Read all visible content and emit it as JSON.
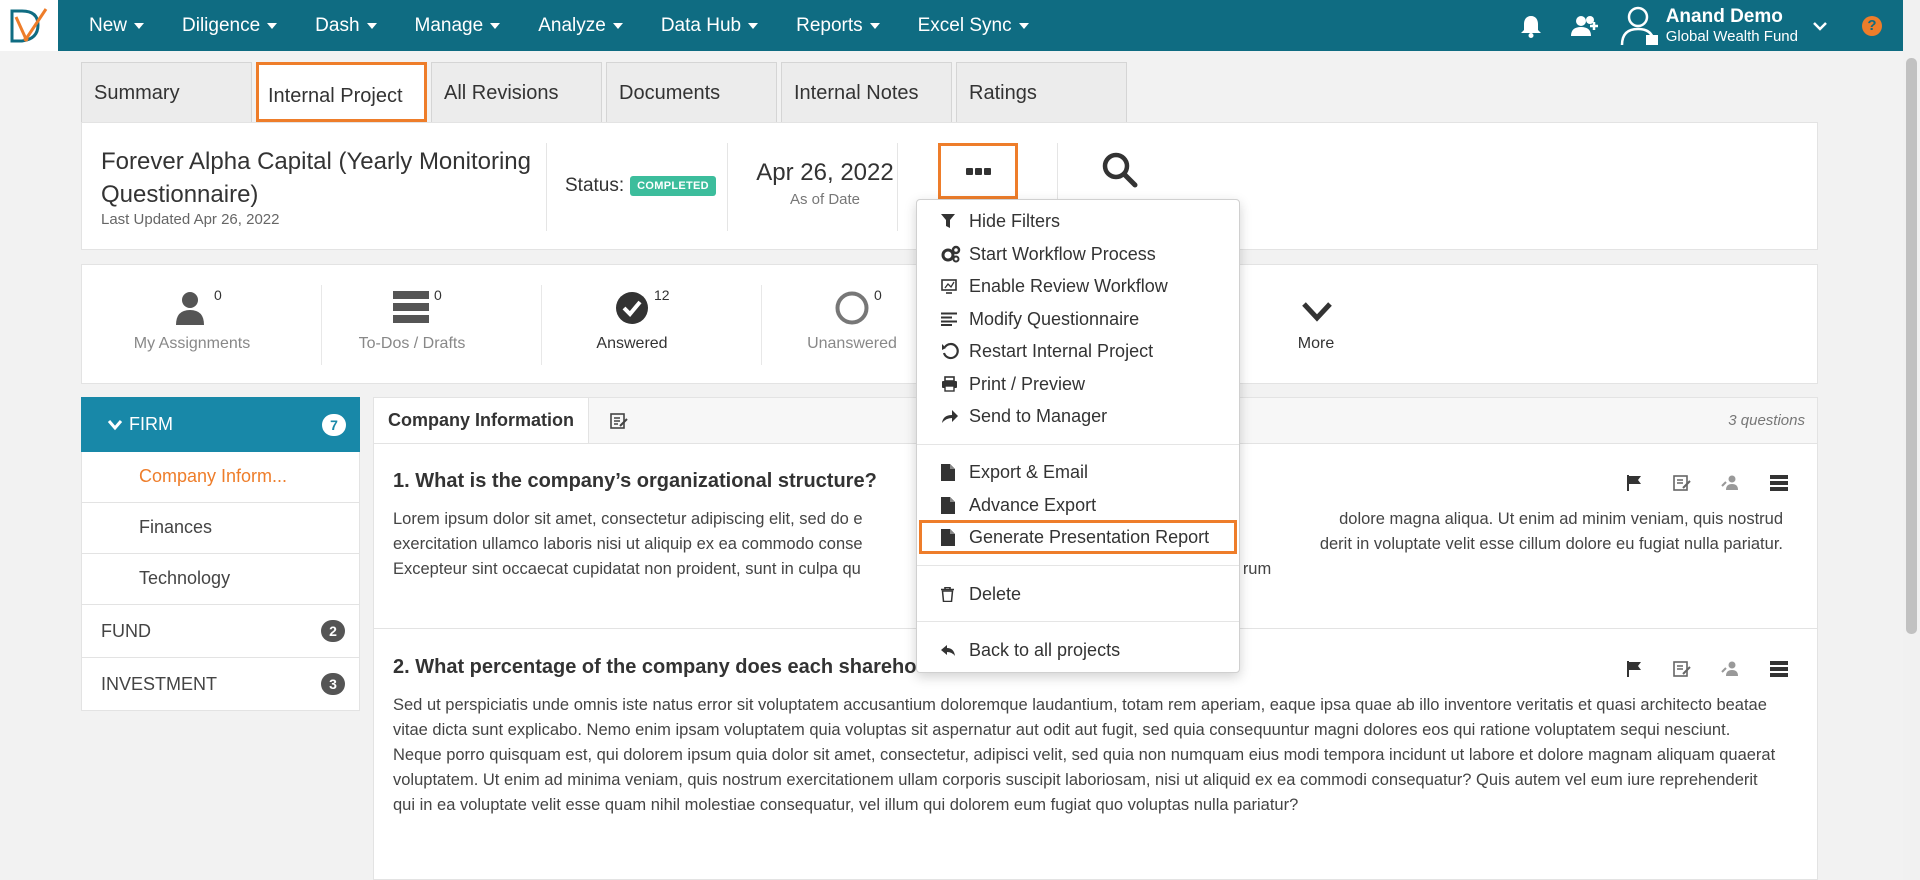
{
  "nav": {
    "items": [
      {
        "label": "New"
      },
      {
        "label": "Diligence"
      },
      {
        "label": "Dash"
      },
      {
        "label": "Manage"
      },
      {
        "label": "Analyze"
      },
      {
        "label": "Data Hub"
      },
      {
        "label": "Reports"
      },
      {
        "label": "Excel Sync"
      }
    ],
    "user_name": "Anand Demo",
    "user_org": "Global Wealth Fund",
    "help_label": "?"
  },
  "tabs": [
    {
      "label": "Summary"
    },
    {
      "label": "Internal Project"
    },
    {
      "label": "All Revisions"
    },
    {
      "label": "Documents"
    },
    {
      "label": "Internal Notes"
    },
    {
      "label": "Ratings"
    }
  ],
  "project": {
    "title": "Forever Alpha Capital (Yearly Monitoring Questionnaire)",
    "updated": "Last Updated Apr 26, 2022",
    "status_label": "Status:",
    "status_badge": "COMPLETED",
    "as_of_date": "Apr 26, 2022",
    "as_of_label": "As of Date"
  },
  "stats": [
    {
      "label": "My Assignments",
      "count": "0"
    },
    {
      "label": "To-Dos / Drafts",
      "count": "0"
    },
    {
      "label": "Answered",
      "count": "12"
    },
    {
      "label": "Unanswered",
      "count": "0"
    },
    {
      "label": "More",
      "count": ""
    }
  ],
  "sidebar": {
    "firm": {
      "label": "FIRM",
      "count": "7"
    },
    "firm_items": [
      {
        "label": "Company Inform..."
      },
      {
        "label": "Finances"
      },
      {
        "label": "Technology"
      }
    ],
    "sections": [
      {
        "label": "FUND",
        "count": "2"
      },
      {
        "label": "INVESTMENT",
        "count": "3"
      }
    ]
  },
  "content": {
    "title": "Company Information",
    "count": "3 questions",
    "questions": [
      {
        "title": "1. What is the company’s organizational structure?",
        "body_left": "Lorem ipsum dolor sit amet, consectetur adipiscing elit, sed do e",
        "body_right": "dolore magna aliqua. Ut enim ad minim veniam, quis nostrud",
        "body_l2_left": "exercitation ullamco laboris nisi ut aliquip ex ea commodo conse",
        "body_l2_right": "derit in voluptate velit esse cillum dolore eu fugiat nulla pariatur.",
        "body_l3_left": "Excepteur sint occaecat cupidatat non proident, sunt in culpa qu",
        "body_l3_right": "rum"
      },
      {
        "title_left": "2. What percentage of the company does each shareho",
        "body": "Sed ut perspiciatis unde omnis iste natus error sit voluptatem accusantium doloremque laudantium, totam rem aperiam, eaque ipsa quae ab illo inventore veritatis et quasi architecto beatae vitae dicta sunt explicabo. Nemo enim ipsam voluptatem quia voluptas sit aspernatur aut odit aut fugit, sed quia consequuntur magni dolores eos qui ratione voluptatem sequi nesciunt. Neque porro quisquam est, qui dolorem ipsum quia dolor sit amet, consectetur, adipisci velit, sed quia non numquam eius modi tempora incidunt ut labore et dolore magnam aliquam quaerat voluptatem. Ut enim ad minima veniam, quis nostrum exercitationem ullam corporis suscipit laboriosam, nisi ut aliquid ex ea commodi consequatur? Quis autem vel eum iure reprehenderit qui in ea voluptate velit esse quam nihil molestiae consequatur, vel illum qui dolorem eum fugiat quo voluptas nulla pariatur?"
      }
    ]
  },
  "dropdown": {
    "items": [
      {
        "label": "Hide Filters",
        "icon": "filter-icon"
      },
      {
        "label": "Start Workflow Process",
        "icon": "cogs-icon"
      },
      {
        "label": "Enable Review Workflow",
        "icon": "monitor-icon"
      },
      {
        "label": "Modify Questionnaire",
        "icon": "align-left-icon"
      },
      {
        "label": "Restart Internal Project",
        "icon": "restart-icon"
      },
      {
        "label": "Print / Preview",
        "icon": "print-icon"
      },
      {
        "label": "Send to Manager",
        "icon": "share-icon"
      },
      {
        "label": "Export & Email",
        "icon": "file-icon"
      },
      {
        "label": "Advance Export",
        "icon": "file-icon"
      },
      {
        "label": "Generate Presentation Report",
        "icon": "file-icon"
      },
      {
        "label": "Delete",
        "icon": "trash-icon"
      },
      {
        "label": "Back to all projects",
        "icon": "reply-icon"
      }
    ]
  },
  "colors": {
    "navbar": "#0f6c82",
    "accent": "#ee7d2a",
    "sidebar_active": "#1888a8",
    "completed": "#3cbd9c"
  }
}
